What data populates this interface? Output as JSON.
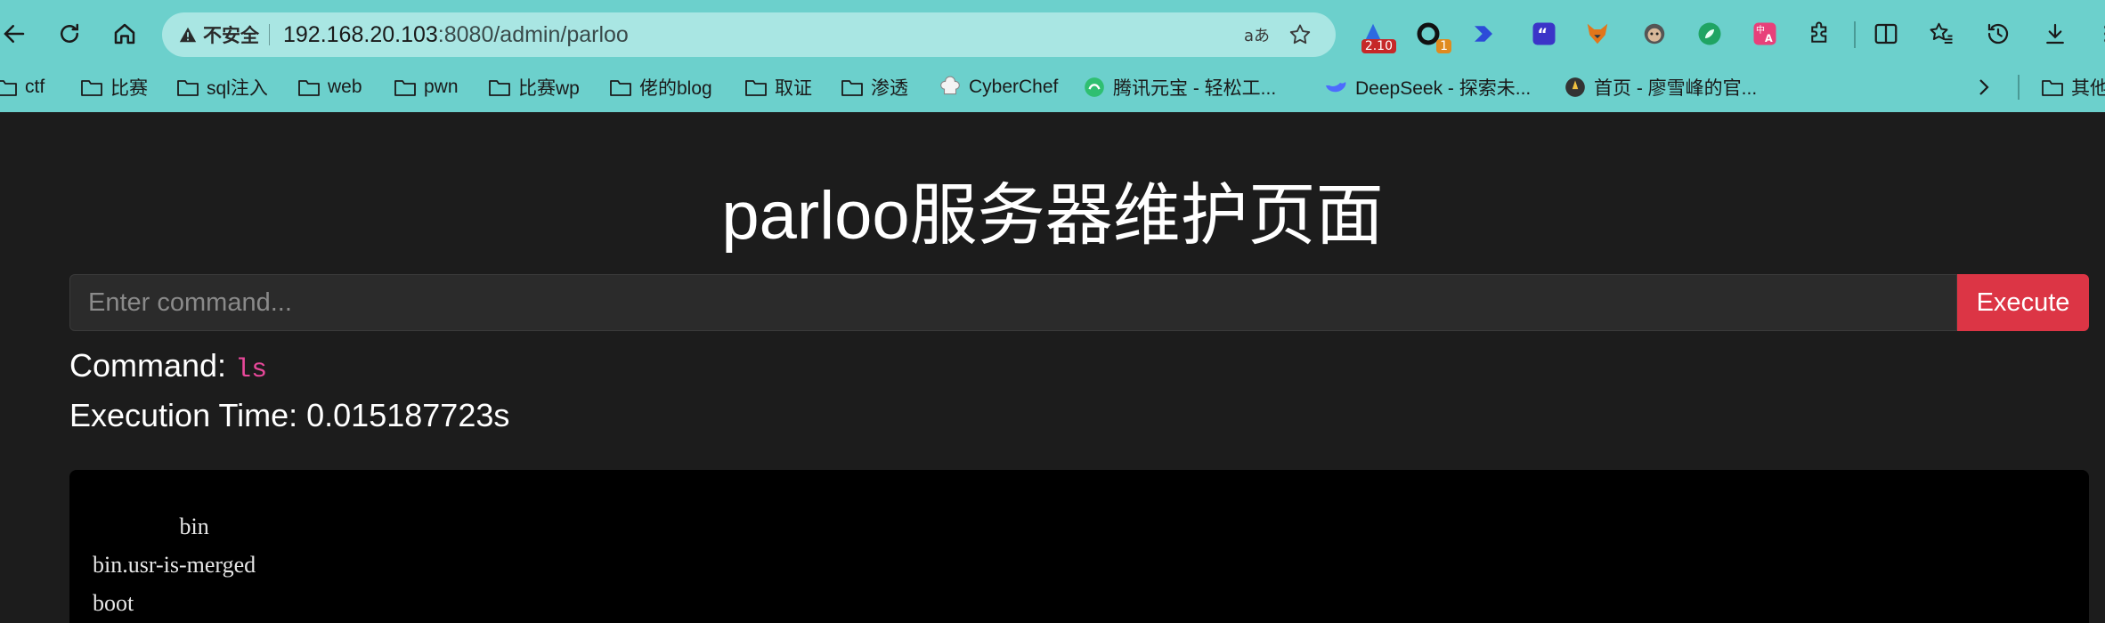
{
  "browser": {
    "security_label": "不安全",
    "url_host": "192.168.20.103",
    "url_rest": ":8080/admin/parloo",
    "extensions": [
      {
        "name": "ext-flag-icon",
        "badge": "2.10",
        "badge_color": "#c62828"
      },
      {
        "name": "ext-ring-icon",
        "badge": "1",
        "badge_color": "#e08a1e"
      },
      {
        "name": "ext-arrow-icon",
        "badge": ""
      },
      {
        "name": "ext-quote-icon",
        "badge": ""
      },
      {
        "name": "ext-fox-icon",
        "badge": ""
      },
      {
        "name": "ext-monkey-icon",
        "badge": ""
      },
      {
        "name": "ext-leaf-icon",
        "badge": ""
      },
      {
        "name": "ext-translate-icon",
        "badge": ""
      }
    ]
  },
  "bookmarks": [
    {
      "label": "ctf",
      "icon": "folder-icon"
    },
    {
      "label": "比赛",
      "icon": "folder-icon"
    },
    {
      "label": "sql注入",
      "icon": "folder-icon"
    },
    {
      "label": "web",
      "icon": "folder-icon"
    },
    {
      "label": "pwn",
      "icon": "folder-icon"
    },
    {
      "label": "比赛wp",
      "icon": "folder-icon"
    },
    {
      "label": "佬的blog",
      "icon": "folder-icon"
    },
    {
      "label": "取证",
      "icon": "folder-icon"
    },
    {
      "label": "渗透",
      "icon": "folder-icon"
    },
    {
      "label": "CyberChef",
      "icon": "chef-hat-icon"
    },
    {
      "label": "腾讯元宝 - 轻松工...",
      "icon": "yuanbao-icon"
    },
    {
      "label": "DeepSeek - 探索未...",
      "icon": "whale-icon"
    },
    {
      "label": "首页 - 廖雪峰的官...",
      "icon": "site-icon"
    },
    {
      "label": "其他",
      "icon": "folder-icon"
    }
  ],
  "page": {
    "title": "parloo服务器维护页面",
    "input_placeholder": "Enter command...",
    "execute_label": "Execute",
    "command_label": "Command:",
    "command_value": "ls",
    "exec_time_label": "Execution Time:",
    "exec_time_value": "0.015187723s",
    "output": "               bin\nbin.usr-is-merged\nboot"
  },
  "colors": {
    "chrome": "#6cd0cc",
    "page_bg": "#1c1c1c",
    "button": "#dc3545",
    "command_code": "#e8489a"
  }
}
